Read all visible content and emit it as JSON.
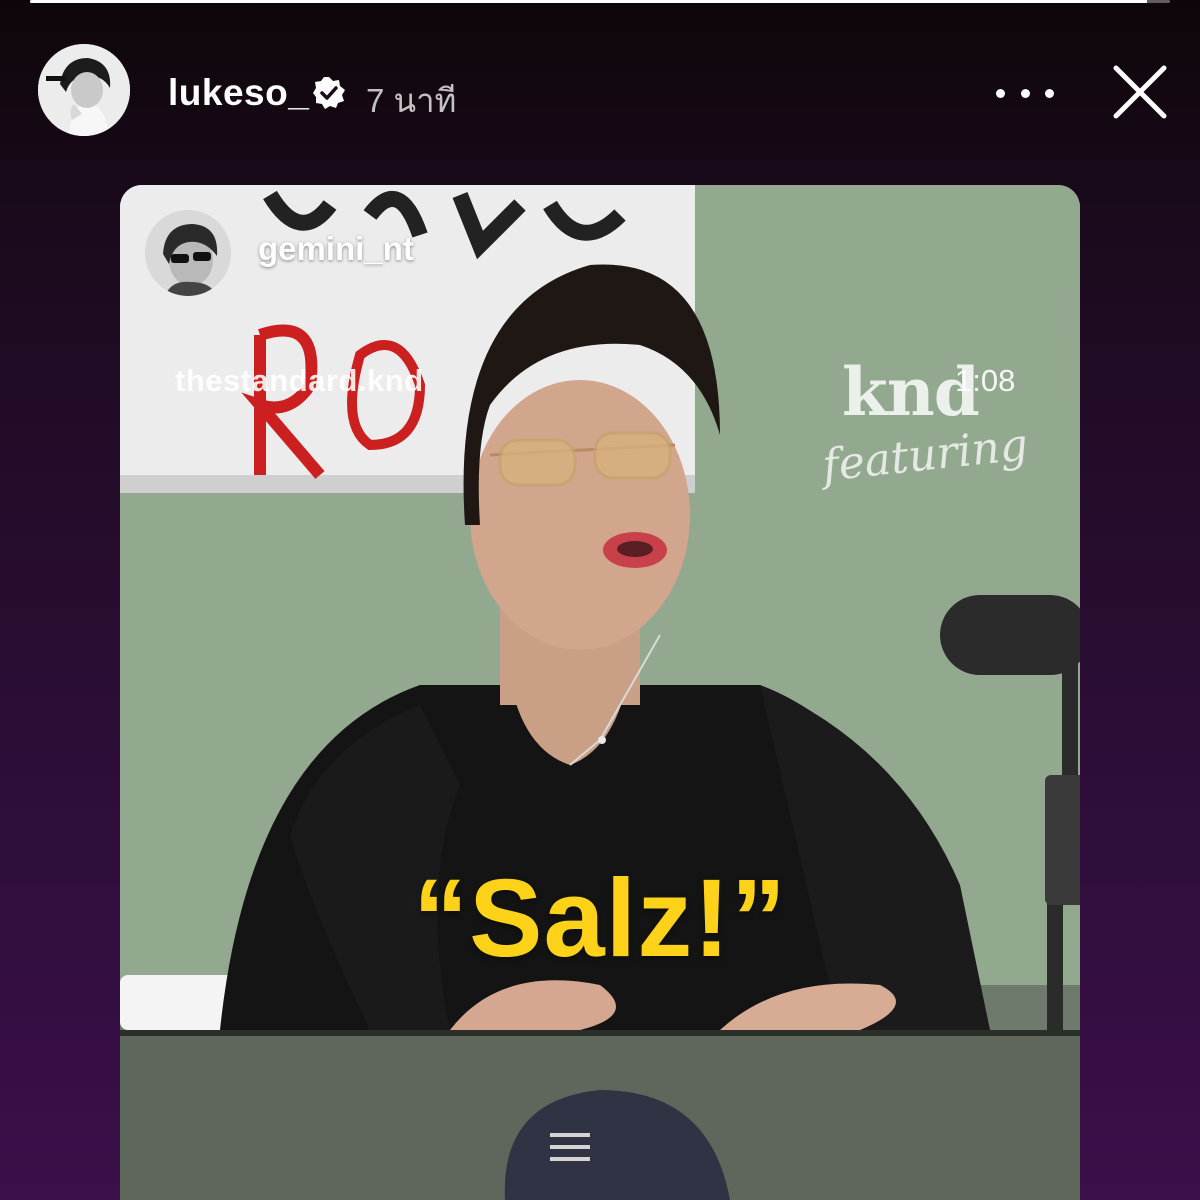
{
  "story": {
    "progress": 0.98,
    "user": {
      "username": "lukeso_",
      "verified": true,
      "time_ago": "7 นาที"
    },
    "actions": {
      "more_icon": "more-horizontal-icon",
      "close_icon": "close-icon"
    }
  },
  "shared_post": {
    "username": "gemini_nt",
    "source_handle": "thestandard.knd",
    "duration": "1:08",
    "brand_name": "knd",
    "brand_tag": "featuring",
    "caption": "“Salz!”"
  },
  "colors": {
    "caption": "#ffd21a",
    "wall": "#8ea48a",
    "background_top": "#0d0609",
    "background_bottom": "#3a0f4a"
  }
}
